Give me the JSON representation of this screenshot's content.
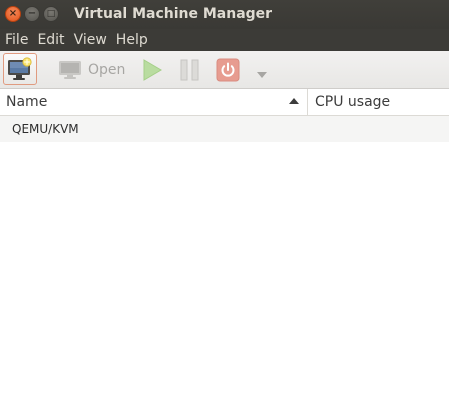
{
  "window": {
    "title": "Virtual Machine Manager",
    "buttons": {
      "close_glyph": "×",
      "minimize_glyph": "−",
      "maximize_glyph": "□"
    }
  },
  "menubar": {
    "items": [
      {
        "label": "File"
      },
      {
        "label": "Edit"
      },
      {
        "label": "View"
      },
      {
        "label": "Help"
      }
    ]
  },
  "toolbar": {
    "new_vm": {
      "icon": "new-vm-icon",
      "enabled": true
    },
    "open": {
      "label": "Open",
      "icon": "monitor-icon",
      "enabled": false
    },
    "run": {
      "icon": "play-icon",
      "enabled": false
    },
    "pause": {
      "icon": "pause-icon",
      "enabled": false
    },
    "shutdown": {
      "icon": "power-icon",
      "enabled": false
    },
    "shutdown_menu": {
      "icon": "chevron-down-icon"
    }
  },
  "table": {
    "columns": [
      {
        "label": "Name",
        "sort": "ascending"
      },
      {
        "label": "CPU usage"
      }
    ],
    "rows": [
      {
        "name": "QEMU/KVM",
        "cpu_usage": ""
      }
    ]
  },
  "colors": {
    "titlebar": "#3c3b37",
    "close_button": "#e9571f",
    "toolbar": "#efeeed",
    "run_disabled": "#b9dca0",
    "shutdown_disabled": "#e79c90"
  }
}
